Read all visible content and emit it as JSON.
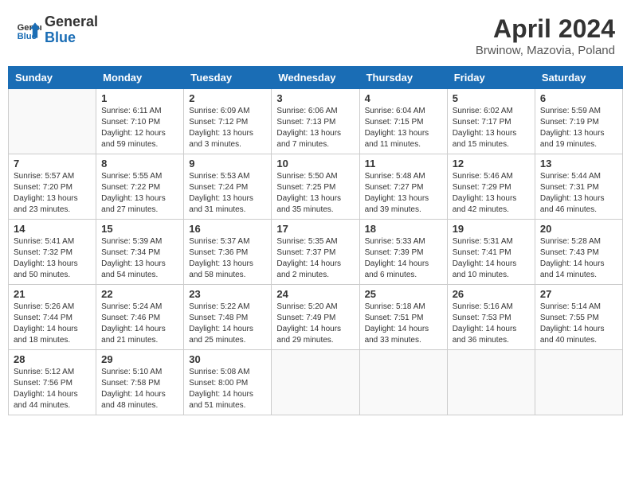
{
  "header": {
    "logo_line1": "General",
    "logo_line2": "Blue",
    "month": "April 2024",
    "location": "Brwinow, Mazovia, Poland"
  },
  "weekdays": [
    "Sunday",
    "Monday",
    "Tuesday",
    "Wednesday",
    "Thursday",
    "Friday",
    "Saturday"
  ],
  "weeks": [
    [
      {
        "day": "",
        "info": ""
      },
      {
        "day": "1",
        "info": "Sunrise: 6:11 AM\nSunset: 7:10 PM\nDaylight: 12 hours\nand 59 minutes."
      },
      {
        "day": "2",
        "info": "Sunrise: 6:09 AM\nSunset: 7:12 PM\nDaylight: 13 hours\nand 3 minutes."
      },
      {
        "day": "3",
        "info": "Sunrise: 6:06 AM\nSunset: 7:13 PM\nDaylight: 13 hours\nand 7 minutes."
      },
      {
        "day": "4",
        "info": "Sunrise: 6:04 AM\nSunset: 7:15 PM\nDaylight: 13 hours\nand 11 minutes."
      },
      {
        "day": "5",
        "info": "Sunrise: 6:02 AM\nSunset: 7:17 PM\nDaylight: 13 hours\nand 15 minutes."
      },
      {
        "day": "6",
        "info": "Sunrise: 5:59 AM\nSunset: 7:19 PM\nDaylight: 13 hours\nand 19 minutes."
      }
    ],
    [
      {
        "day": "7",
        "info": "Sunrise: 5:57 AM\nSunset: 7:20 PM\nDaylight: 13 hours\nand 23 minutes."
      },
      {
        "day": "8",
        "info": "Sunrise: 5:55 AM\nSunset: 7:22 PM\nDaylight: 13 hours\nand 27 minutes."
      },
      {
        "day": "9",
        "info": "Sunrise: 5:53 AM\nSunset: 7:24 PM\nDaylight: 13 hours\nand 31 minutes."
      },
      {
        "day": "10",
        "info": "Sunrise: 5:50 AM\nSunset: 7:25 PM\nDaylight: 13 hours\nand 35 minutes."
      },
      {
        "day": "11",
        "info": "Sunrise: 5:48 AM\nSunset: 7:27 PM\nDaylight: 13 hours\nand 39 minutes."
      },
      {
        "day": "12",
        "info": "Sunrise: 5:46 AM\nSunset: 7:29 PM\nDaylight: 13 hours\nand 42 minutes."
      },
      {
        "day": "13",
        "info": "Sunrise: 5:44 AM\nSunset: 7:31 PM\nDaylight: 13 hours\nand 46 minutes."
      }
    ],
    [
      {
        "day": "14",
        "info": "Sunrise: 5:41 AM\nSunset: 7:32 PM\nDaylight: 13 hours\nand 50 minutes."
      },
      {
        "day": "15",
        "info": "Sunrise: 5:39 AM\nSunset: 7:34 PM\nDaylight: 13 hours\nand 54 minutes."
      },
      {
        "day": "16",
        "info": "Sunrise: 5:37 AM\nSunset: 7:36 PM\nDaylight: 13 hours\nand 58 minutes."
      },
      {
        "day": "17",
        "info": "Sunrise: 5:35 AM\nSunset: 7:37 PM\nDaylight: 14 hours\nand 2 minutes."
      },
      {
        "day": "18",
        "info": "Sunrise: 5:33 AM\nSunset: 7:39 PM\nDaylight: 14 hours\nand 6 minutes."
      },
      {
        "day": "19",
        "info": "Sunrise: 5:31 AM\nSunset: 7:41 PM\nDaylight: 14 hours\nand 10 minutes."
      },
      {
        "day": "20",
        "info": "Sunrise: 5:28 AM\nSunset: 7:43 PM\nDaylight: 14 hours\nand 14 minutes."
      }
    ],
    [
      {
        "day": "21",
        "info": "Sunrise: 5:26 AM\nSunset: 7:44 PM\nDaylight: 14 hours\nand 18 minutes."
      },
      {
        "day": "22",
        "info": "Sunrise: 5:24 AM\nSunset: 7:46 PM\nDaylight: 14 hours\nand 21 minutes."
      },
      {
        "day": "23",
        "info": "Sunrise: 5:22 AM\nSunset: 7:48 PM\nDaylight: 14 hours\nand 25 minutes."
      },
      {
        "day": "24",
        "info": "Sunrise: 5:20 AM\nSunset: 7:49 PM\nDaylight: 14 hours\nand 29 minutes."
      },
      {
        "day": "25",
        "info": "Sunrise: 5:18 AM\nSunset: 7:51 PM\nDaylight: 14 hours\nand 33 minutes."
      },
      {
        "day": "26",
        "info": "Sunrise: 5:16 AM\nSunset: 7:53 PM\nDaylight: 14 hours\nand 36 minutes."
      },
      {
        "day": "27",
        "info": "Sunrise: 5:14 AM\nSunset: 7:55 PM\nDaylight: 14 hours\nand 40 minutes."
      }
    ],
    [
      {
        "day": "28",
        "info": "Sunrise: 5:12 AM\nSunset: 7:56 PM\nDaylight: 14 hours\nand 44 minutes."
      },
      {
        "day": "29",
        "info": "Sunrise: 5:10 AM\nSunset: 7:58 PM\nDaylight: 14 hours\nand 48 minutes."
      },
      {
        "day": "30",
        "info": "Sunrise: 5:08 AM\nSunset: 8:00 PM\nDaylight: 14 hours\nand 51 minutes."
      },
      {
        "day": "",
        "info": ""
      },
      {
        "day": "",
        "info": ""
      },
      {
        "day": "",
        "info": ""
      },
      {
        "day": "",
        "info": ""
      }
    ]
  ]
}
